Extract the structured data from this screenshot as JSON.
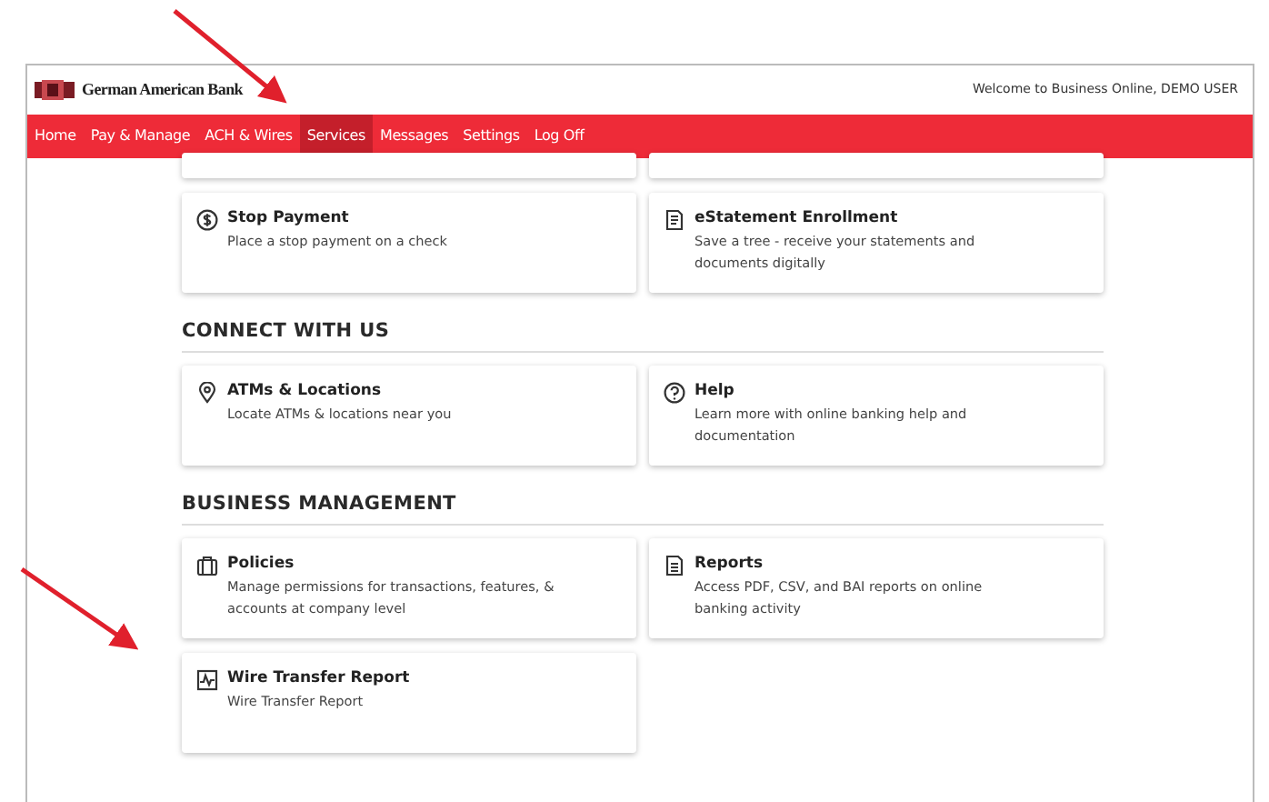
{
  "header": {
    "bank_name": "German American Bank",
    "welcome": "Welcome to Business Online, DEMO USER"
  },
  "nav": [
    {
      "label": "Home",
      "selected": false
    },
    {
      "label": "Pay & Manage",
      "selected": false
    },
    {
      "label": "ACH & Wires",
      "selected": false
    },
    {
      "label": "Services",
      "selected": true
    },
    {
      "label": "Messages",
      "selected": false
    },
    {
      "label": "Settings",
      "selected": false
    },
    {
      "label": "Log Off",
      "selected": false
    }
  ],
  "sections": [
    {
      "cards": [
        {
          "title": "Stop Payment",
          "description": "Place a stop payment on a check"
        },
        {
          "title": "eStatement Enrollment",
          "description": "Save a tree - receive your statements and documents digitally"
        }
      ]
    },
    {
      "heading": "CONNECT WITH US",
      "cards": [
        {
          "title": "ATMs & Locations",
          "description": "Locate ATMs & locations near you"
        },
        {
          "title": "Help",
          "description": "Learn more with online banking help and documentation"
        }
      ]
    },
    {
      "heading": "BUSINESS MANAGEMENT",
      "cards": [
        {
          "title": "Policies",
          "description": "Manage permissions for transactions, features, & accounts at company level"
        },
        {
          "title": "Reports",
          "description": "Access PDF, CSV, and BAI reports on online banking activity"
        },
        {
          "title": "Wire Transfer Report",
          "description": "Wire Transfer Report"
        }
      ]
    }
  ]
}
